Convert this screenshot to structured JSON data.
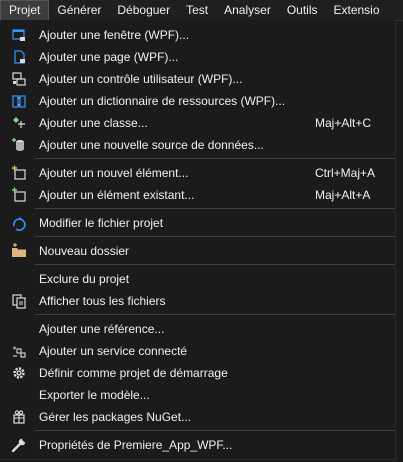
{
  "menubar": {
    "items": [
      "Projet",
      "Générer",
      "Déboguer",
      "Test",
      "Analyser",
      "Outils",
      "Extensio"
    ]
  },
  "menu": {
    "items": [
      {
        "label": "Ajouter une fenêtre (WPF)...",
        "shortcut": "",
        "icon": "window-add-icon"
      },
      {
        "label": "Ajouter une page (WPF)...",
        "shortcut": "",
        "icon": "page-add-icon"
      },
      {
        "label": "Ajouter un contrôle utilisateur (WPF)...",
        "shortcut": "",
        "icon": "user-control-icon"
      },
      {
        "label": "Ajouter un dictionnaire de ressources (WPF)...",
        "shortcut": "",
        "icon": "resource-dictionary-icon"
      },
      {
        "label": "Ajouter une classe...",
        "shortcut": "Maj+Alt+C",
        "icon": "class-icon"
      },
      {
        "label": "Ajouter une nouvelle source de données...",
        "shortcut": "",
        "icon": "data-source-icon"
      },
      {
        "label": "Ajouter un nouvel élément...",
        "shortcut": "Ctrl+Maj+A",
        "icon": "new-item-icon"
      },
      {
        "label": "Ajouter un élément existant...",
        "shortcut": "Maj+Alt+A",
        "icon": "existing-item-icon"
      },
      {
        "label": "Modifier le fichier projet",
        "shortcut": "",
        "icon": "refresh-icon"
      },
      {
        "label": "Nouveau dossier",
        "shortcut": "",
        "icon": "new-folder-icon"
      },
      {
        "label": "Exclure du projet",
        "shortcut": "",
        "icon": ""
      },
      {
        "label": "Afficher tous les fichiers",
        "shortcut": "",
        "icon": "show-all-files-icon"
      },
      {
        "label": "Ajouter une référence...",
        "shortcut": "",
        "icon": ""
      },
      {
        "label": "Ajouter un service connecté",
        "shortcut": "",
        "icon": "connected-service-icon"
      },
      {
        "label": "Définir comme projet de démarrage",
        "shortcut": "",
        "icon": "gear-icon"
      },
      {
        "label": "Exporter le modèle...",
        "shortcut": "",
        "icon": ""
      },
      {
        "label": "Gérer les packages NuGet...",
        "shortcut": "",
        "icon": "nuget-icon"
      },
      {
        "label": "Propriétés de Premiere_App_WPF...",
        "shortcut": "",
        "icon": "wrench-icon"
      }
    ]
  },
  "colors": {
    "background": "#1b1b1c",
    "menubar_background": "#1f1f1f",
    "text": "#f1f1f1",
    "separator": "#3f3f46",
    "accent_blue": "#3794ff",
    "folder_yellow": "#dcb67a",
    "green": "#89d185"
  }
}
